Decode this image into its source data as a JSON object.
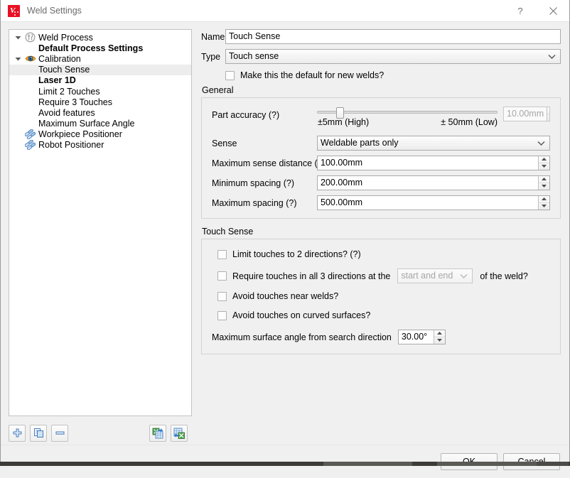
{
  "window": {
    "title": "Weld Settings",
    "app_icon": "weld-app-icon",
    "help_label": "?",
    "close_label": "✕"
  },
  "tree": {
    "items": [
      {
        "label": "Weld Process",
        "icon": "weld-process-icon",
        "twisty": "expanded",
        "bold": false,
        "indent": 0,
        "selected": false
      },
      {
        "label": "Default Process Settings",
        "icon": "none",
        "twisty": "none",
        "bold": true,
        "indent": 1,
        "selected": false
      },
      {
        "label": "Calibration",
        "icon": "eye-icon",
        "twisty": "expanded",
        "bold": false,
        "indent": 0,
        "selected": false
      },
      {
        "label": "Touch Sense",
        "icon": "none",
        "twisty": "none",
        "bold": false,
        "indent": 1,
        "selected": true
      },
      {
        "label": "Laser 1D",
        "icon": "none",
        "twisty": "none",
        "bold": true,
        "indent": 1,
        "selected": false
      },
      {
        "label": "Limit 2 Touches",
        "icon": "none",
        "twisty": "none",
        "bold": false,
        "indent": 1,
        "selected": false
      },
      {
        "label": "Require 3 Touches",
        "icon": "none",
        "twisty": "none",
        "bold": false,
        "indent": 1,
        "selected": false
      },
      {
        "label": "Avoid features",
        "icon": "none",
        "twisty": "none",
        "bold": false,
        "indent": 1,
        "selected": false
      },
      {
        "label": "Maximum Surface Angle",
        "icon": "none",
        "twisty": "none",
        "bold": false,
        "indent": 1,
        "selected": false
      },
      {
        "label": "Workpiece Positioner",
        "icon": "positioner-icon",
        "twisty": "none",
        "bold": false,
        "indent": 0,
        "selected": false
      },
      {
        "label": "Robot Positioner",
        "icon": "positioner-icon",
        "twisty": "none",
        "bold": false,
        "indent": 0,
        "selected": false
      }
    ]
  },
  "tree_toolbar": {
    "add": "add-icon",
    "duplicate": "duplicate-icon",
    "remove": "remove-icon",
    "import": "import-icon",
    "export": "export-icon"
  },
  "form": {
    "name_label": "Name",
    "name_value": "Touch Sense",
    "type_label": "Type",
    "type_value": "Touch sense",
    "default_checkbox_label": "Make this the default for new welds?",
    "default_checkbox_checked": false
  },
  "general": {
    "title": "General",
    "part_accuracy_label": "Part accuracy (?)",
    "part_accuracy_slider_value": 10,
    "part_accuracy_slider_percent": 10.5,
    "part_accuracy_min_label": "±5mm (High)",
    "part_accuracy_max_label": "± 50mm (Low)",
    "part_accuracy_value": "10.00mm",
    "part_accuracy_disabled": true,
    "sense_label": "Sense",
    "sense_value": "Weldable parts only",
    "max_sense_distance_label": "Maximum sense distance (?)",
    "max_sense_distance_value": "100.00mm",
    "minimum_spacing_label": "Minimum spacing (?)",
    "minimum_spacing_value": "200.00mm",
    "maximum_spacing_label": "Maximum spacing (?)",
    "maximum_spacing_value": "500.00mm"
  },
  "touch_sense": {
    "title": "Touch Sense",
    "limit_touches_label": "Limit touches to 2 directions? (?)",
    "limit_touches_checked": false,
    "require_touches_label": "Require touches in all 3 directions at the",
    "require_touches_checked": false,
    "require_touches_position": "start and end",
    "require_touches_suffix": "of the weld?",
    "avoid_near_welds_label": "Avoid touches near welds?",
    "avoid_near_welds_checked": false,
    "avoid_curved_label": "Avoid touches on curved surfaces?",
    "avoid_curved_checked": false,
    "max_surface_angle_label": "Maximum surface angle from search direction",
    "max_surface_angle_value": "30.00°"
  },
  "footer": {
    "ok_label": "OK",
    "cancel_label": "Cancel"
  },
  "colors": {
    "accent_red": "#e81123",
    "window_bg": "#f0f0f0",
    "field_bg": "#ffffff",
    "border": "#aaaaaa",
    "selected_row": "#ededed",
    "disabled_text": "#a6a6a6"
  }
}
